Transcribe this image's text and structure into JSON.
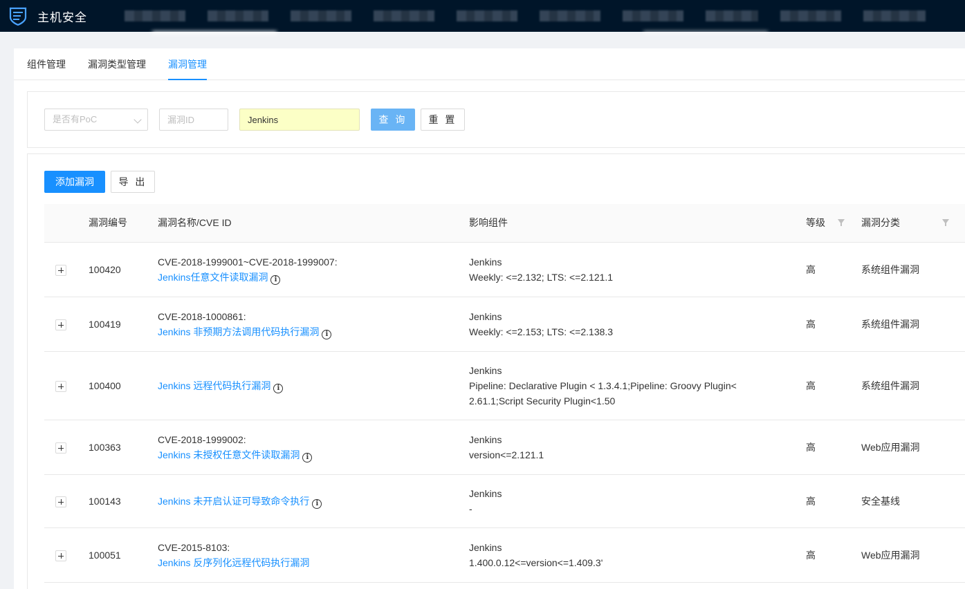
{
  "app": {
    "title": "主机安全",
    "logo_icon": "shield-server-icon"
  },
  "tabs": [
    {
      "label": "组件管理",
      "active": false
    },
    {
      "label": "漏洞类型管理",
      "active": false
    },
    {
      "label": "漏洞管理",
      "active": true
    }
  ],
  "filters": {
    "poc_select": {
      "placeholder": "是否有PoC"
    },
    "vuln_id": {
      "placeholder": "漏洞ID",
      "value": ""
    },
    "keyword": {
      "value": "Jenkins"
    },
    "query_label": "查 询",
    "reset_label": "重 置"
  },
  "toolbar": {
    "add_label": "添加漏洞",
    "export_label": "导 出"
  },
  "table": {
    "columns": {
      "id": "漏洞编号",
      "name": "漏洞名称/CVE ID",
      "component": "影响组件",
      "level": "等级",
      "category": "漏洞分类"
    },
    "rows": [
      {
        "id": "100420",
        "cve": "CVE-2018-1999001~CVE-2018-1999007:",
        "name": "Jenkins任意文件读取漏洞",
        "component": "Jenkins",
        "versions": "Weekly: <=2.132; LTS: <=2.121.1",
        "versions2": "",
        "level": "高",
        "category": "系统组件漏洞",
        "info": true
      },
      {
        "id": "100419",
        "cve": "CVE-2018-1000861:",
        "name": "Jenkins 非预期方法调用代码执行漏洞",
        "component": "Jenkins",
        "versions": "Weekly: <=2.153; LTS: <=2.138.3",
        "versions2": "",
        "level": "高",
        "category": "系统组件漏洞",
        "info": true
      },
      {
        "id": "100400",
        "cve": "",
        "name": "Jenkins 远程代码执行漏洞",
        "component": "Jenkins",
        "versions": "Pipeline: Declarative Plugin < 1.3.4.1;Pipeline: Groovy Plugin<",
        "versions2": "2.61.1;Script Security Plugin<1.50",
        "level": "高",
        "category": "系统组件漏洞",
        "info": true
      },
      {
        "id": "100363",
        "cve": "CVE-2018-1999002:",
        "name": "Jenkins 未授权任意文件读取漏洞",
        "component": "Jenkins",
        "versions": "version<=2.121.1",
        "versions2": "",
        "level": "高",
        "category": "Web应用漏洞",
        "info": true
      },
      {
        "id": "100143",
        "cve": "",
        "name": "Jenkins 未开启认证可导致命令执行",
        "component": "Jenkins",
        "versions": "-",
        "versions2": "",
        "level": "高",
        "category": "安全基线",
        "info": true
      },
      {
        "id": "100051",
        "cve": "CVE-2015-8103:",
        "name": "Jenkins 反序列化远程代码执行漏洞",
        "component": "Jenkins",
        "versions": "1.400.0.12<=version<=1.409.3'",
        "versions2": "",
        "level": "高",
        "category": "Web应用漏洞",
        "info": false
      }
    ]
  },
  "colors": {
    "topbar": "#001529",
    "accent": "#1890ff",
    "highlight_input": "#fcffc6"
  }
}
